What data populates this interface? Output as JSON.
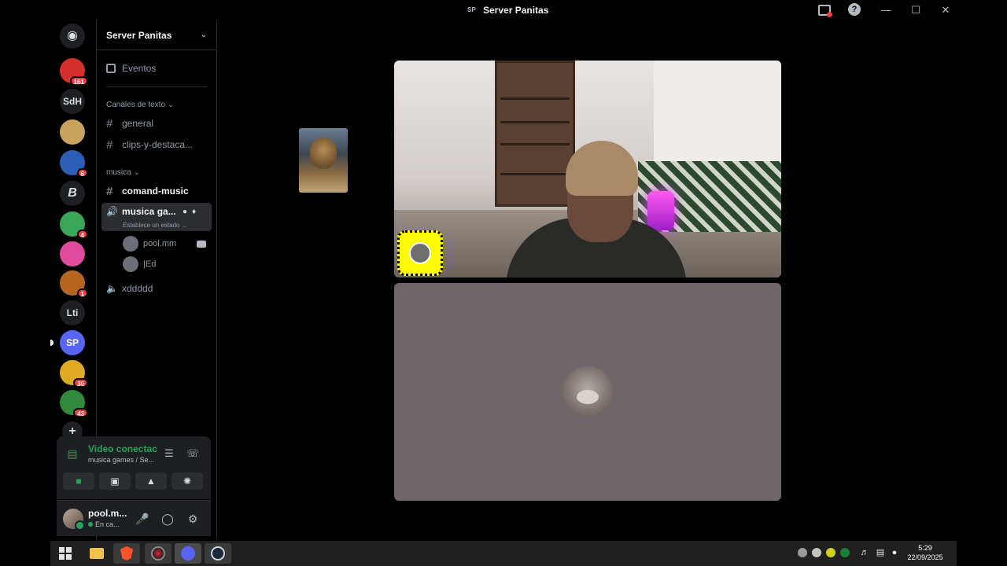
{
  "window": {
    "title": "Server Panitas",
    "title_glyph": "SP"
  },
  "rail": {
    "servers": [
      {
        "label": "",
        "badge": "161",
        "color": "#d4312d"
      },
      {
        "label": "SdH",
        "badge": "",
        "color": "#1e1f22"
      },
      {
        "label": "",
        "badge": "",
        "color": "#c9a25d"
      },
      {
        "label": "",
        "badge": "6",
        "color": "#2d5fb7"
      },
      {
        "label": "",
        "badge": "",
        "color": "#1e1f22"
      },
      {
        "label": "",
        "badge": "4",
        "color": "#3aa657"
      },
      {
        "label": "",
        "badge": "",
        "color": "#e04b9d"
      },
      {
        "label": "",
        "badge": "1",
        "color": "#b8651f"
      },
      {
        "label": "Lti",
        "badge": "",
        "color": "#1e1f22"
      },
      {
        "label": "SP",
        "badge": "",
        "color": "#5865f2"
      },
      {
        "label": "",
        "badge": "30",
        "color": "#e0a923"
      },
      {
        "label": "",
        "badge": "43",
        "color": "#2f8a3c"
      }
    ],
    "letter_b": "B"
  },
  "sidebar": {
    "guild_name": "Server Panitas",
    "events_label": "Eventos",
    "category_text": "Canales de texto",
    "text_channels": [
      "general",
      "clips-y-destaca..."
    ],
    "category_music": "musica",
    "music_channels": [
      "comand-music"
    ],
    "active_voice": {
      "name": "musica ga...",
      "status": "Establece un estado ..."
    },
    "voice_users": [
      "pool.mm",
      "|Ed"
    ],
    "other_voice": "xddddd"
  },
  "voice_panel": {
    "title": "Video conectac",
    "subtitle": "musica games / Se..."
  },
  "user_panel": {
    "name": "pool.m...",
    "status": "En ca..."
  },
  "taskbar": {
    "time": "5:29",
    "date": "22/09/2025"
  },
  "colors": {
    "accent": "#5865f2",
    "connected": "#23a55a",
    "badge": "#f23f42",
    "avatar_tile": "#6f6669"
  }
}
